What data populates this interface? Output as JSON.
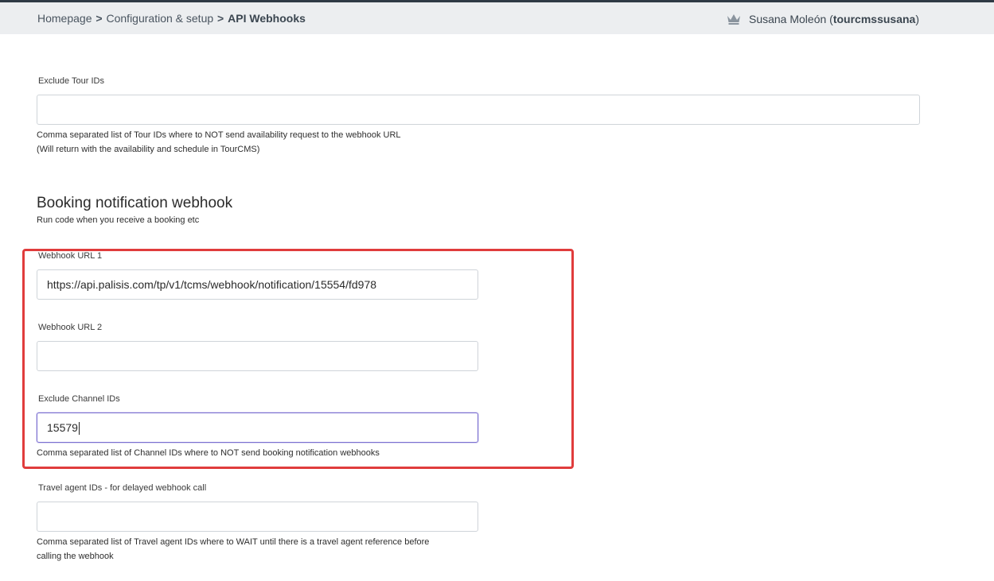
{
  "breadcrumb": {
    "items": [
      {
        "label": "Homepage"
      },
      {
        "label": "Configuration & setup"
      },
      {
        "label": "API Webhooks"
      }
    ],
    "separator": ">"
  },
  "user": {
    "icon": "crown-icon",
    "name": "Susana Moleón",
    "username_open": "(",
    "username": "tourcmssusana",
    "username_close": ")"
  },
  "exclude_tour": {
    "label": "Exclude Tour IDs",
    "value": "",
    "help_line1": "Comma separated list of Tour IDs where to NOT send availability request to the webhook URL",
    "help_line2": "(Will return with the availability and schedule in TourCMS)"
  },
  "booking_section": {
    "title": "Booking notification webhook",
    "subtitle": "Run code when you receive a booking etc"
  },
  "webhook_url_1": {
    "label": "Webhook URL 1",
    "value": "https://api.palisis.com/tp/v1/tcms/webhook/notification/15554/fd978"
  },
  "webhook_url_2": {
    "label": "Webhook URL 2",
    "value": ""
  },
  "exclude_channel": {
    "label": "Exclude Channel IDs",
    "value": "15579",
    "help": "Comma separated list of Channel IDs where to NOT send booking notification webhooks"
  },
  "travel_agent": {
    "label": "Travel agent IDs - for delayed webhook call",
    "value": "",
    "help_line1": "Comma separated list of Travel agent IDs where to WAIT until there is a travel agent reference before",
    "help_line2": "calling the webhook"
  },
  "colors": {
    "highlight": "#e03c3c",
    "focus": "#7b6fd1",
    "header_bg": "#eceef0"
  }
}
